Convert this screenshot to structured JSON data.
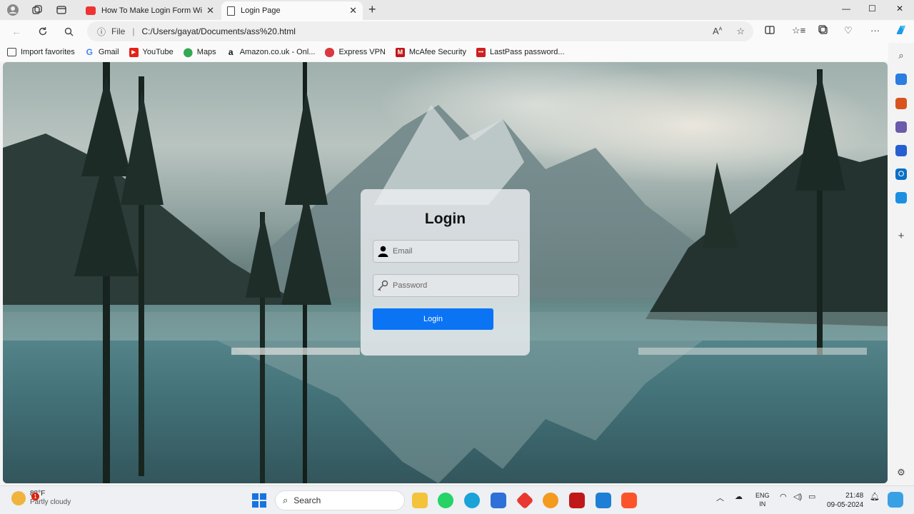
{
  "browser": {
    "tabs": [
      {
        "title": "How To Make Login Form With H",
        "active": false
      },
      {
        "title": "Login Page",
        "active": true
      }
    ],
    "address": {
      "scheme_label": "File",
      "url": "C:/Users/gayat/Documents/ass%20.html"
    },
    "favorites": [
      {
        "label": "Import favorites",
        "icon": "import-icon",
        "color": "#444444"
      },
      {
        "label": "Gmail",
        "icon": "google-icon",
        "color": "#4285f4"
      },
      {
        "label": "YouTube",
        "icon": "youtube-icon",
        "color": "#e62117"
      },
      {
        "label": "Maps",
        "icon": "maps-icon",
        "color": "#34a853"
      },
      {
        "label": "Amazon.co.uk - Onl...",
        "icon": "amazon-icon",
        "color": "#111111"
      },
      {
        "label": "Express VPN",
        "icon": "expressvpn-icon",
        "color": "#da3940"
      },
      {
        "label": "McAfee Security",
        "icon": "mcafee-icon",
        "color": "#c01818"
      },
      {
        "label": "LastPass password...",
        "icon": "lastpass-icon",
        "color": "#cc1f1f"
      }
    ]
  },
  "login": {
    "title": "Login",
    "email_placeholder": "Email",
    "password_placeholder": "Password",
    "button_label": "Login"
  },
  "taskbar": {
    "weather": {
      "temp": "88°F",
      "condition": "Partly cloudy",
      "badge": "1"
    },
    "search_label": "Search",
    "language": {
      "line1": "ENG",
      "line2": "IN"
    },
    "time": "21:48",
    "date": "09-05-2024"
  },
  "colors": {
    "accent": "#0a74f5"
  }
}
